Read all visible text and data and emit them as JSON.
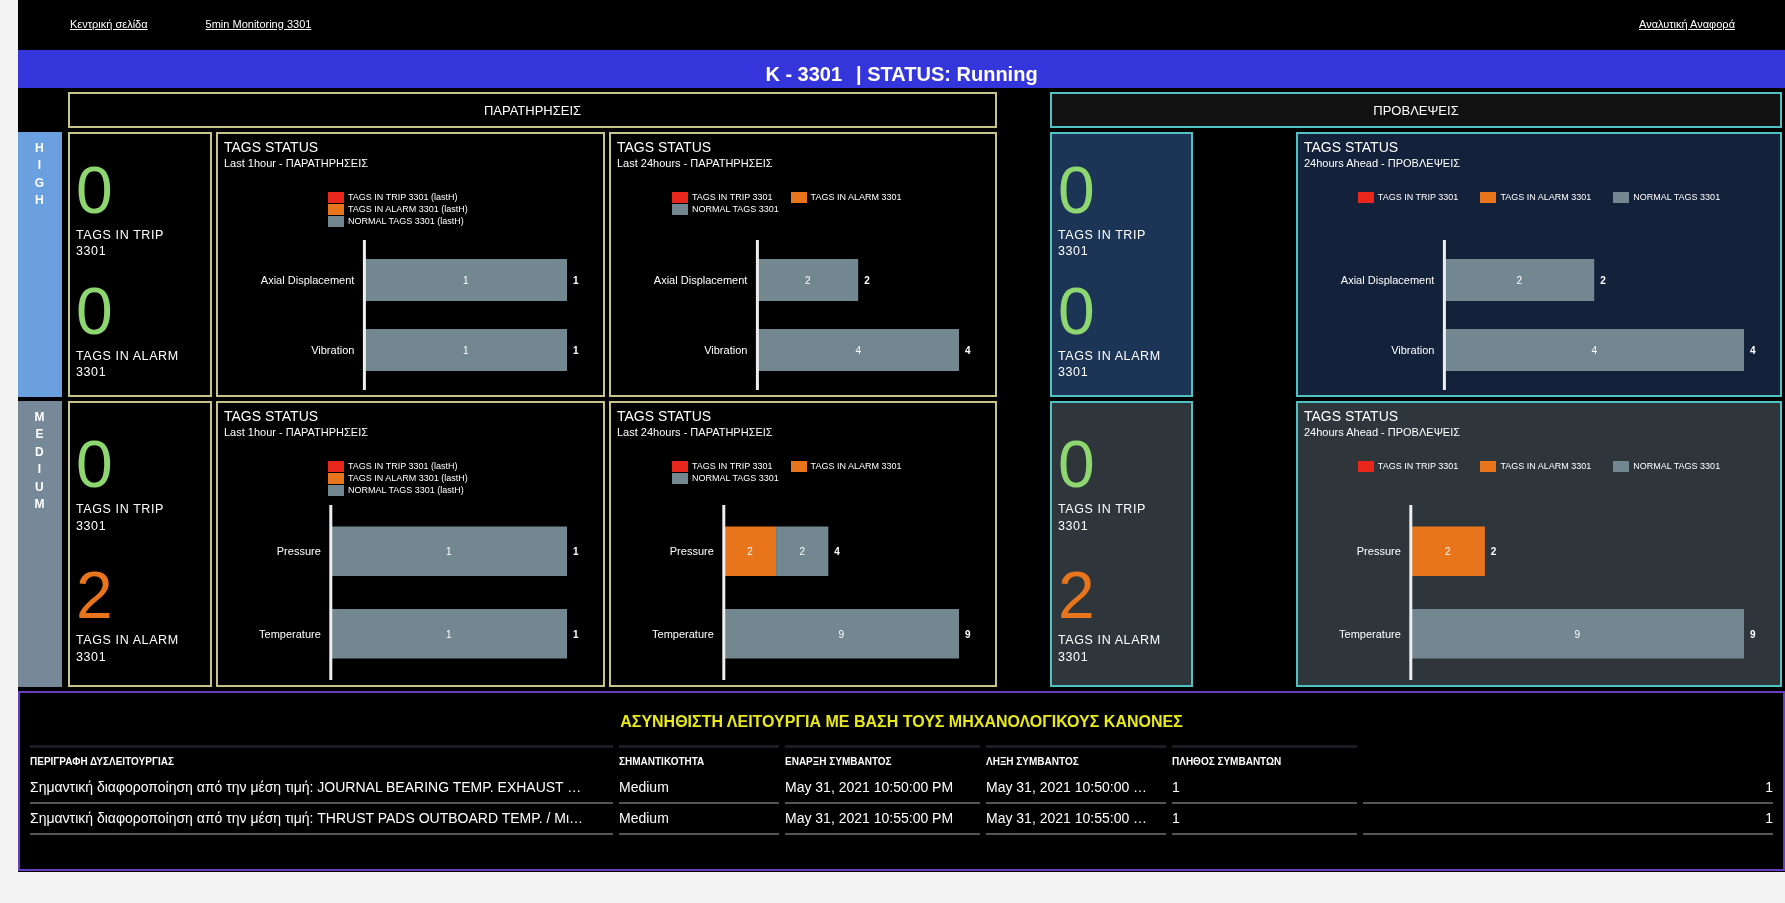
{
  "nav": {
    "links": [
      {
        "label": "Κεντρική σελίδα"
      },
      {
        "label": "5min Monitoring 3301"
      }
    ],
    "right_link": {
      "label": "Αναλυτική Αναφορά"
    }
  },
  "header": {
    "title": "K - 3301",
    "status": "| STATUS: Running"
  },
  "sections": [
    {
      "label": "ΠΑΡΑΤΗΡΗΣΕΙΣ"
    },
    {
      "label": "ΠΡΟΒΛΕΨΕΙΣ"
    }
  ],
  "levels": [
    {
      "label": "HIGH",
      "color": "#6a9fe0",
      "observations": {
        "kpis": [
          {
            "value": "0",
            "label": "TAGS IN TRIP 3301",
            "color": "#8ed66f"
          },
          {
            "value": "0",
            "label": "TAGS IN ALARM 3301",
            "color": "#8ed66f"
          }
        ],
        "charts": [
          {
            "subtitle": "Last 1hour - ΠΑΡΑΤΗΡΗΣΕΙΣ",
            "chart_data": {
              "type": "bar",
              "orientation": "horizontal",
              "stacked": true,
              "title": "TAGS STATUS",
              "categories": [
                "Axial Displacement",
                "Vibration"
              ],
              "series": [
                {
                  "name": "TAGS IN TRIP 3301 (lastH)",
                  "color": "#e8261c",
                  "values": [
                    0,
                    0
                  ],
                  "value_labels": [
                    null,
                    null
                  ]
                },
                {
                  "name": "TAGS IN ALARM 3301 (lastH)",
                  "color": "#e8741c",
                  "values": [
                    0,
                    0
                  ],
                  "value_labels": [
                    null,
                    null
                  ]
                },
                {
                  "name": "NORMAL TAGS 3301 (lastH)",
                  "color": "#72878f",
                  "values": [
                    1,
                    1
                  ],
                  "value_labels": [
                    "1",
                    "1"
                  ]
                }
              ],
              "totals": [
                "1",
                "1"
              ]
            }
          },
          {
            "subtitle": "Last 24hours - ΠΑΡΑΤΗΡΗΣΕΙΣ",
            "chart_data": {
              "type": "bar",
              "orientation": "horizontal",
              "stacked": true,
              "title": "TAGS STATUS",
              "categories": [
                "Axial Displacement",
                "Vibration"
              ],
              "series": [
                {
                  "name": "TAGS IN TRIP 3301",
                  "color": "#e8261c",
                  "values": [
                    0,
                    0
                  ],
                  "value_labels": [
                    null,
                    null
                  ]
                },
                {
                  "name": "TAGS IN ALARM 3301",
                  "color": "#e8741c",
                  "values": [
                    0,
                    0
                  ],
                  "value_labels": [
                    null,
                    null
                  ]
                },
                {
                  "name": "NORMAL TAGS 3301",
                  "color": "#72878f",
                  "values": [
                    2,
                    4
                  ],
                  "value_labels": [
                    "2",
                    "4"
                  ]
                }
              ],
              "totals": [
                "2",
                "4"
              ]
            }
          }
        ]
      },
      "predictions": {
        "kpis": [
          {
            "value": "0",
            "label": "TAGS IN TRIP 3301",
            "color": "#8ed66f"
          },
          {
            "value": "0",
            "label": "TAGS IN ALARM 3301",
            "color": "#8ed66f"
          }
        ],
        "charts": [
          {
            "subtitle": "24hours Ahead - ΠΡΟΒΛΕΨΕΙΣ",
            "chart_data": {
              "type": "bar",
              "orientation": "horizontal",
              "stacked": true,
              "title": "TAGS STATUS",
              "categories": [
                "Axial Displacement",
                "Vibration"
              ],
              "series": [
                {
                  "name": "TAGS IN TRIP 3301",
                  "color": "#e8261c",
                  "values": [
                    0,
                    0
                  ],
                  "value_labels": [
                    null,
                    null
                  ]
                },
                {
                  "name": "TAGS IN ALARM 3301",
                  "color": "#e8741c",
                  "values": [
                    0,
                    0
                  ],
                  "value_labels": [
                    null,
                    null
                  ]
                },
                {
                  "name": "NORMAL TAGS 3301",
                  "color": "#72878f",
                  "values": [
                    2,
                    4
                  ],
                  "value_labels": [
                    "2",
                    "4"
                  ]
                }
              ],
              "totals": [
                "2",
                "4"
              ]
            }
          }
        ]
      }
    },
    {
      "label": "MEDIUM",
      "color": "#778899",
      "observations": {
        "kpis": [
          {
            "value": "0",
            "label": "TAGS IN TRIP 3301",
            "color": "#8ed66f"
          },
          {
            "value": "2",
            "label": "TAGS IN ALARM 3301",
            "color": "#e8741c"
          }
        ],
        "charts": [
          {
            "subtitle": "Last 1hour - ΠΑΡΑΤΗΡΗΣΕΙΣ",
            "chart_data": {
              "type": "bar",
              "orientation": "horizontal",
              "stacked": true,
              "title": "TAGS STATUS",
              "categories": [
                "Pressure",
                "Temperature"
              ],
              "series": [
                {
                  "name": "TAGS IN TRIP 3301 (lastH)",
                  "color": "#e8261c",
                  "values": [
                    0,
                    0
                  ],
                  "value_labels": [
                    null,
                    null
                  ]
                },
                {
                  "name": "TAGS IN ALARM 3301 (lastH)",
                  "color": "#e8741c",
                  "values": [
                    0,
                    0
                  ],
                  "value_labels": [
                    null,
                    null
                  ]
                },
                {
                  "name": "NORMAL TAGS 3301 (lastH)",
                  "color": "#72878f",
                  "values": [
                    1,
                    1
                  ],
                  "value_labels": [
                    "1",
                    "1"
                  ]
                }
              ],
              "totals": [
                "1",
                "1"
              ]
            }
          },
          {
            "subtitle": "Last 24hours - ΠΑΡΑΤΗΡΗΣΕΙΣ",
            "chart_data": {
              "type": "bar",
              "orientation": "horizontal",
              "stacked": true,
              "title": "TAGS STATUS",
              "categories": [
                "Pressure",
                "Temperature"
              ],
              "series": [
                {
                  "name": "TAGS IN TRIP 3301",
                  "color": "#e8261c",
                  "values": [
                    0,
                    0
                  ],
                  "value_labels": [
                    null,
                    null
                  ]
                },
                {
                  "name": "TAGS IN ALARM 3301",
                  "color": "#e8741c",
                  "values": [
                    2,
                    0
                  ],
                  "value_labels": [
                    "2",
                    null
                  ]
                },
                {
                  "name": "NORMAL TAGS 3301",
                  "color": "#72878f",
                  "values": [
                    2,
                    9
                  ],
                  "value_labels": [
                    "2",
                    "9"
                  ]
                }
              ],
              "totals": [
                "4",
                "9"
              ]
            }
          }
        ]
      },
      "predictions": {
        "kpis": [
          {
            "value": "0",
            "label": "TAGS IN TRIP 3301",
            "color": "#8ed66f"
          },
          {
            "value": "2",
            "label": "TAGS IN ALARM 3301",
            "color": "#e8741c"
          }
        ],
        "charts": [
          {
            "subtitle": "24hours Ahead - ΠΡΟΒΛΕΨΕΙΣ",
            "chart_data": {
              "type": "bar",
              "orientation": "horizontal",
              "stacked": true,
              "title": "TAGS STATUS",
              "categories": [
                "Pressure",
                "Temperature"
              ],
              "series": [
                {
                  "name": "TAGS IN TRIP 3301",
                  "color": "#e8261c",
                  "values": [
                    0,
                    0
                  ],
                  "value_labels": [
                    null,
                    null
                  ]
                },
                {
                  "name": "TAGS IN ALARM 3301",
                  "color": "#e8741c",
                  "values": [
                    2,
                    0
                  ],
                  "value_labels": [
                    "2",
                    null
                  ]
                },
                {
                  "name": "NORMAL TAGS 3301",
                  "color": "#72878f",
                  "values": [
                    0,
                    9
                  ],
                  "value_labels": [
                    null,
                    "9"
                  ]
                }
              ],
              "totals": [
                "2",
                "9"
              ]
            }
          }
        ]
      }
    }
  ],
  "table": {
    "title": "ΑΣΥΝΗΘΙΣΤΗ ΛΕΙΤΟΥΡΓΙΑ ΜΕ ΒΑΣΗ ΤΟΥΣ ΜΗΧΑΝΟΛΟΓΙΚΟΥΣ ΚΑΝΟΝΕΣ",
    "columns": [
      "ΠΕΡΙΓΡΑΦΗ ΔΥΣΛΕΙΤΟΥΡΓΙΑΣ",
      "ΣΗΜΑΝΤΙΚΟΤΗΤΑ",
      "ΕΝΑΡΞΗ ΣΥΜΒΑΝΤΟΣ",
      "ΛΗΞΗ ΣΥΜΒΑΝΤΟΣ",
      "ΠΛΗΘΟΣ ΣΥΜΒΑΝΤΩΝ"
    ],
    "rows": [
      [
        "Σημαντική διαφοροποίηση από την μέση τιμή: JOURNAL BEARING TEMP. EXHAUST …",
        "Medium",
        "May 31, 2021 10:50:00 PM",
        "May 31, 2021 10:50:00 …",
        "1",
        "1"
      ],
      [
        "Σημαντική διαφοροποίηση από την μέση τιμή: THRUST PADS OUTBOARD TEMP. / Μι…",
        "Medium",
        "May 31, 2021 10:55:00 PM",
        "May 31, 2021 10:55:00 …",
        "1",
        "1"
      ]
    ]
  }
}
